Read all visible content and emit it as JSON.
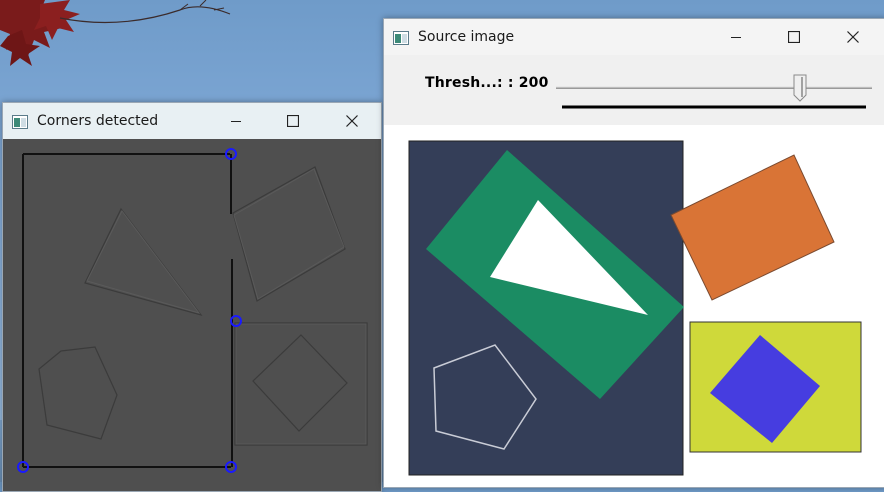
{
  "desktop": {
    "wallpaper": "sky-with-maple-leaves"
  },
  "corners_window": {
    "title": "Corners detected",
    "icon": "opencv-window-icon",
    "controls": [
      "minimize-icon",
      "maximize-icon",
      "close-icon"
    ],
    "background_color": "#4f4f4f",
    "corner_marker_color": "#1a1aff"
  },
  "source_window": {
    "title": "Source image",
    "icon": "opencv-window-icon",
    "controls": [
      "minimize-icon",
      "maximize-icon",
      "close-icon"
    ],
    "trackbar": {
      "label": "Thresh...: : 200",
      "value": 200,
      "max": 255
    },
    "colors": {
      "navy_panel": "#343e58",
      "green_rect": "#1b8c63",
      "white_triangle": "#ffffff",
      "orange_rect": "#d97436",
      "yellow_square": "#cfd93a",
      "blue_diamond": "#463de0",
      "pentagon_outline": "#c9ccd6"
    }
  }
}
